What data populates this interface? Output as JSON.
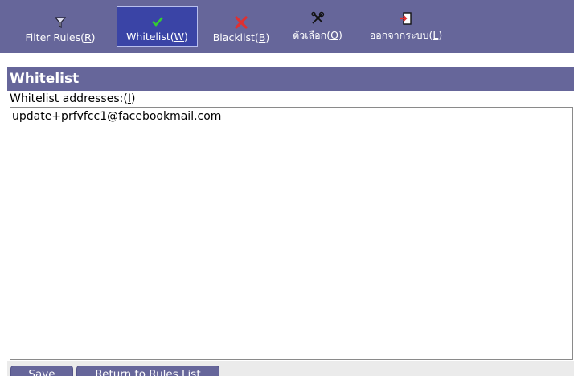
{
  "toolbar": {
    "items": [
      {
        "label_prefix": "Filter Rules(",
        "key": "R",
        "label_suffix": ")",
        "icon": "filter-icon"
      },
      {
        "label_prefix": "Whitelist(",
        "key": "W",
        "label_suffix": ")",
        "icon": "checkmark-icon",
        "active": true
      },
      {
        "label_prefix": "Blacklist(",
        "key": "B",
        "label_suffix": ")",
        "icon": "red-x-icon"
      },
      {
        "label_prefix": "ตัวเลือก(",
        "key": "O",
        "label_suffix": ")",
        "icon": "tools-icon"
      },
      {
        "label_prefix": "ออกจากระบบ(",
        "key": "L",
        "label_suffix": ")",
        "icon": "logout-icon"
      }
    ]
  },
  "section": {
    "title": "Whitelist"
  },
  "form": {
    "label_prefix": "Whitelist addresses:(",
    "label_key": "I",
    "label_suffix": ")",
    "addresses": "update+prfvfcc1@facebookmail.com"
  },
  "buttons": {
    "save": "Save",
    "return": "Return to Rules List"
  },
  "colors": {
    "toolbar_bg": "#66669a",
    "active_bg": "#3a44a6",
    "check": "#33cc33",
    "x": "#e03030"
  }
}
